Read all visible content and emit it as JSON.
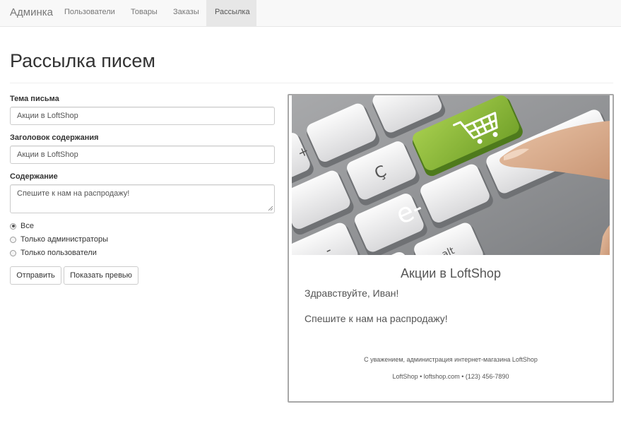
{
  "navbar": {
    "brand": "Админка",
    "items": [
      {
        "label": "Пользователи",
        "active": false
      },
      {
        "label": "Товары",
        "active": false
      },
      {
        "label": "Заказы",
        "active": false
      },
      {
        "label": "Рассылка",
        "active": true
      }
    ]
  },
  "page": {
    "title": "Рассылка писем"
  },
  "form": {
    "subject_label": "Тема письма",
    "subject_value": "Акции в LoftShop",
    "heading_label": "Заголовок содержания",
    "heading_value": "Акции в LoftShop",
    "content_label": "Содержание",
    "content_value": "Спешите к нам на распродажу!",
    "recipients": [
      {
        "label": "Все",
        "checked": true
      },
      {
        "label": "Только администраторы",
        "checked": false
      },
      {
        "label": "Только пользователи",
        "checked": false
      }
    ],
    "send_button": "Отправить",
    "preview_button": "Показать превью"
  },
  "preview": {
    "banner_icon": "e-commerce-cart-key-image",
    "banner_text": "e-",
    "heading": "Акции в LoftShop",
    "greeting": "Здравствуйте, Иван!",
    "body": "Спешите к нам на распродажу!",
    "signature": "С уважением, администрация интернет-магазина LoftShop",
    "contact": "LoftShop • loftshop.com • (123) 456-7890"
  },
  "colors": {
    "navbar_bg": "#f8f8f8",
    "nav_active_bg": "#e7e7e7",
    "key_green": "#8dbb3b",
    "preview_border": "#a8a8a8"
  }
}
